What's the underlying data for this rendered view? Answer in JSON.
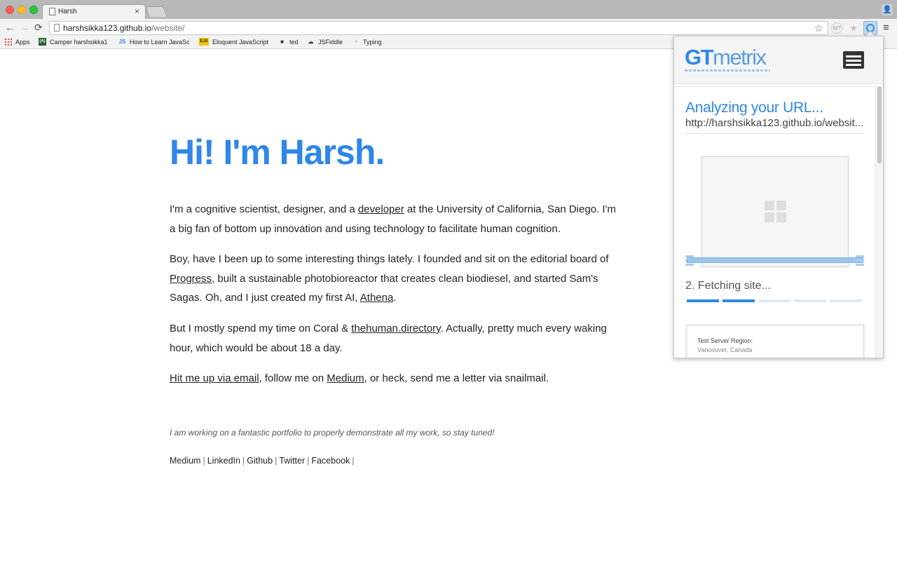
{
  "browser": {
    "tab_title": "Harsh",
    "tab_close": "×",
    "url_host": "harshsikka123.github.io",
    "url_path": "/website/",
    "nav": {
      "back": "←",
      "forward": "→",
      "reload": "⟳",
      "star": "☆",
      "menu": "≡",
      "profile": "👤"
    },
    "extensions": {
      "ext1": "M?",
      "ext2": "★"
    },
    "bookmarks": [
      {
        "label": "Apps",
        "icon": "apps-grid-icon"
      },
      {
        "label": "Camper harshsikka1",
        "icon": "freecodecamp-icon",
        "icon_text": "(A)"
      },
      {
        "label": "How to Learn JavaSc",
        "icon": "js-icon",
        "icon_text": "JS"
      },
      {
        "label": "Eloquent JavaScript",
        "icon": "ejs-icon",
        "icon_text": "EJS"
      },
      {
        "label": "ted",
        "icon": "ted-icon",
        "icon_text": "■"
      },
      {
        "label": "JSFiddle",
        "icon": "jsfiddle-cloud-icon",
        "icon_text": "☁"
      },
      {
        "label": "Typing",
        "icon": "typing-icon",
        "icon_text": "◔"
      }
    ]
  },
  "page": {
    "heading": "Hi! I'm Harsh.",
    "p1": {
      "t1": "I'm a cognitive scientist, designer, and a ",
      "link": "developer",
      "t2": " at the University of California, San Diego. I'm a big fan of bottom up innovation and using technology to facilitate human cognition."
    },
    "p2": {
      "t1": "Boy, have I been up to some interesting things lately. I founded and sit on the editorial board of ",
      "link1": "Progress",
      "t2": ", built a sustainable photobioreactor that creates clean biodiesel, and started Sam's Sagas. Oh, and I just created my first AI, ",
      "link2": "Athena",
      "t3": "."
    },
    "p3": {
      "t1": "But I mostly spend my time on Coral & ",
      "link": "thehuman.directory",
      "t2": ". Actually, pretty much every waking hour, which would be about 18 a day."
    },
    "p4": {
      "link1": "Hit me up via email",
      "t1": ", follow me on ",
      "link2": "Medium",
      "t2": ", or heck, send me a letter via snailmail."
    },
    "note": "I am working on a fantastic portfolio to properly demonstrate all my work, so stay tuned!",
    "footer_links": [
      "Medium",
      "LinkedIn",
      "Github",
      "Twitter",
      "Facebook"
    ],
    "footer_sep": "|"
  },
  "gtmetrix": {
    "logo_gt": "GT",
    "logo_metrix": "metrix",
    "status_title": "Analyzing your URL...",
    "status_url": "http://harshsikka123.github.io/websit...",
    "stage": "2. Fetching site...",
    "steps_total": 5,
    "steps_done": 2,
    "region_label": "Test Server Region:",
    "region_value": "Vancouver, Canada"
  },
  "colors": {
    "accent": "#2f86e8",
    "link_text": "#222222"
  }
}
